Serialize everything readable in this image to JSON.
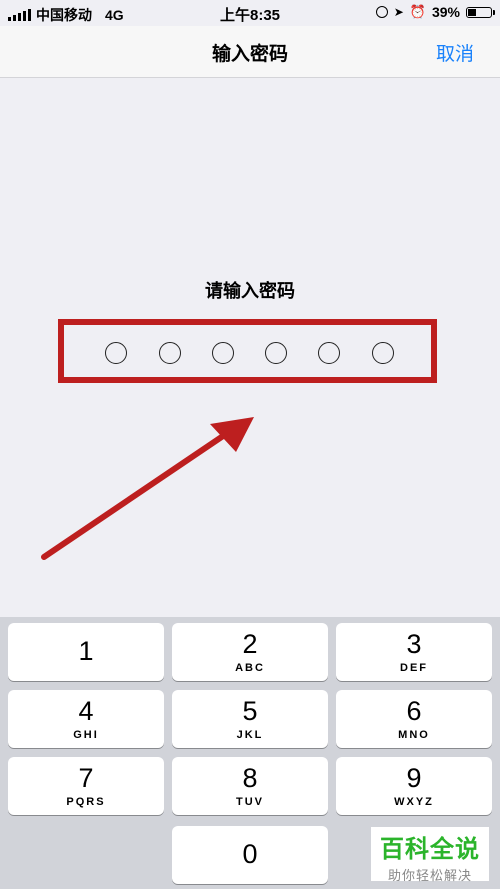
{
  "status_bar": {
    "carrier": "中国移动",
    "network": "4G",
    "time": "上午8:35",
    "battery": "39%",
    "battery_level": 0.39
  },
  "nav": {
    "title": "输入密码",
    "cancel_label": "取消"
  },
  "prompt": "请输入密码",
  "pin_length": 6,
  "annotation_color": "#bd1f1f",
  "accent_color": "#1a82fb",
  "keypad": [
    {
      "digit": "1",
      "letters": ""
    },
    {
      "digit": "2",
      "letters": "ABC"
    },
    {
      "digit": "3",
      "letters": "DEF"
    },
    {
      "digit": "4",
      "letters": "GHI"
    },
    {
      "digit": "5",
      "letters": "JKL"
    },
    {
      "digit": "6",
      "letters": "MNO"
    },
    {
      "digit": "7",
      "letters": "PQRS"
    },
    {
      "digit": "8",
      "letters": "TUV"
    },
    {
      "digit": "9",
      "letters": "WXYZ"
    },
    {
      "digit": "0",
      "letters": ""
    }
  ],
  "watermark": {
    "main": "百科全说",
    "sub": "助你轻松解决"
  }
}
